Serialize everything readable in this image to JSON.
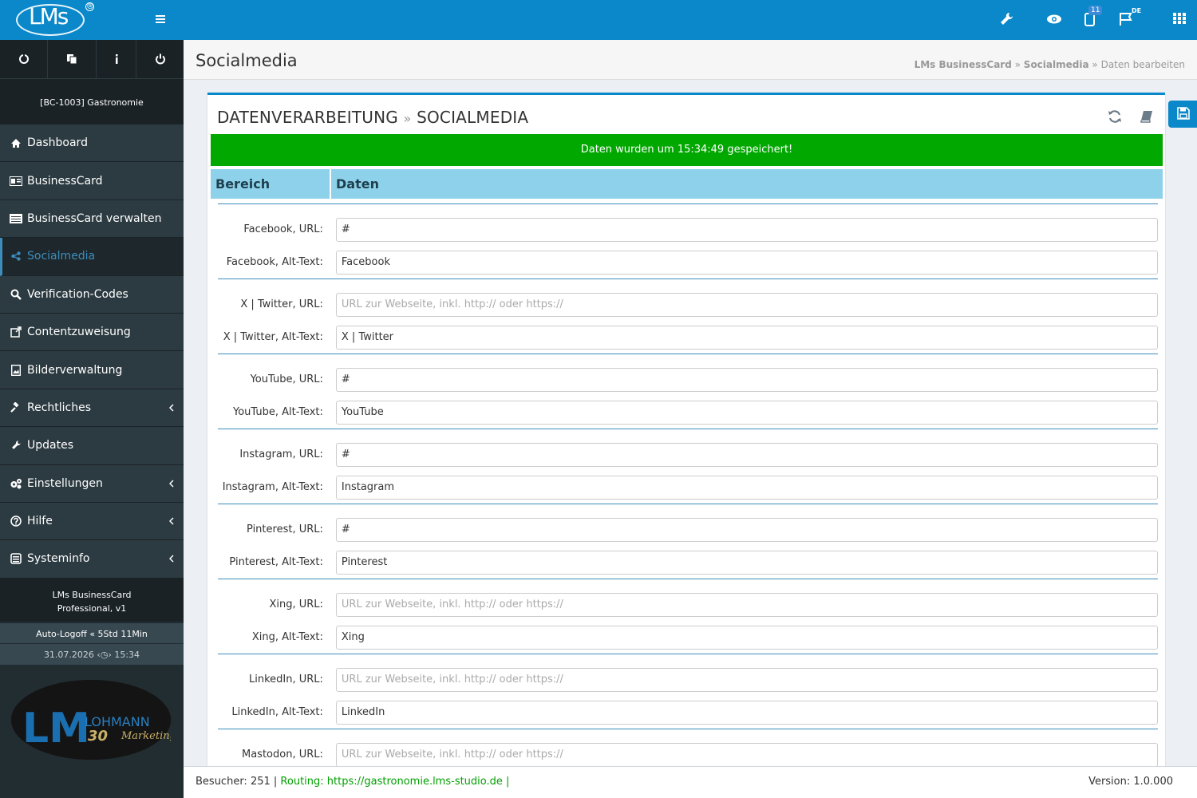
{
  "header": {
    "logo_text": "LMs",
    "logo_registered": "®",
    "notification_count": "11",
    "language": "DE"
  },
  "sidebar": {
    "client": "[BC-1003] Gastronomie",
    "items": [
      {
        "label": "Dashboard",
        "icon": "home-icon"
      },
      {
        "label": "BusinessCard",
        "icon": "id-card-icon"
      },
      {
        "label": "BusinessCard verwalten",
        "icon": "list-icon"
      },
      {
        "label": "Socialmedia",
        "icon": "share-icon"
      },
      {
        "label": "Verification-Codes",
        "icon": "search-icon"
      },
      {
        "label": "Contentzuweisung",
        "icon": "external-link-icon"
      },
      {
        "label": "Bilderverwaltung",
        "icon": "image-icon"
      },
      {
        "label": "Rechtliches",
        "icon": "gavel-icon"
      },
      {
        "label": "Updates",
        "icon": "wrench-icon"
      },
      {
        "label": "Einstellungen",
        "icon": "cogs-icon"
      },
      {
        "label": "Hilfe",
        "icon": "question-icon"
      },
      {
        "label": "Systeminfo",
        "icon": "archive-icon"
      }
    ],
    "product_line1": "LMs BusinessCard",
    "product_line2": "Professional, v1",
    "auto_logoff_label": "Auto-Logoff",
    "auto_logoff_value": "5Std 11Min",
    "date": "31.07.2026",
    "time": "15:34"
  },
  "page": {
    "title": "Socialmedia",
    "breadcrumb": [
      "LMs BusinessCard",
      "Socialmedia",
      "Daten bearbeiten"
    ]
  },
  "box": {
    "title_part1": "DATENVERARBEITUNG",
    "title_part2": "SOCIALMEDIA",
    "success_message": "Daten wurden um 15:34:49 gespeichert!",
    "col_area": "Bereich",
    "col_data": "Daten",
    "placeholder": "URL zur Webseite, inkl. http:// oder https://"
  },
  "fields": [
    {
      "url_label": "Facebook, URL:",
      "url_value": "#",
      "alt_label": "Facebook, Alt-Text:",
      "alt_value": "Facebook"
    },
    {
      "url_label": "X | Twitter, URL:",
      "url_value": "",
      "alt_label": "X | Twitter, Alt-Text:",
      "alt_value": "X | Twitter"
    },
    {
      "url_label": "YouTube, URL:",
      "url_value": "#",
      "alt_label": "YouTube, Alt-Text:",
      "alt_value": "YouTube"
    },
    {
      "url_label": "Instagram, URL:",
      "url_value": "#",
      "alt_label": "Instagram, Alt-Text:",
      "alt_value": "Instagram"
    },
    {
      "url_label": "Pinterest, URL:",
      "url_value": "#",
      "alt_label": "Pinterest, Alt-Text:",
      "alt_value": "Pinterest"
    },
    {
      "url_label": "Xing, URL:",
      "url_value": "",
      "alt_label": "Xing, Alt-Text:",
      "alt_value": "Xing"
    },
    {
      "url_label": "LinkedIn, URL:",
      "url_value": "",
      "alt_label": "LinkedIn, Alt-Text:",
      "alt_value": "LinkedIn"
    },
    {
      "url_label": "Mastodon, URL:",
      "url_value": "",
      "alt_label": "",
      "alt_value": ""
    }
  ],
  "footer": {
    "visitors": "Besucher: 251 |",
    "routing": "Routing: https://gastronomie.lms-studio.de |",
    "version": "Version: 1.0.000"
  },
  "colors": {
    "brand": "#0a88c9",
    "sidebar": "#222d32",
    "success": "#00a800",
    "table_header": "#8dd2ea"
  }
}
